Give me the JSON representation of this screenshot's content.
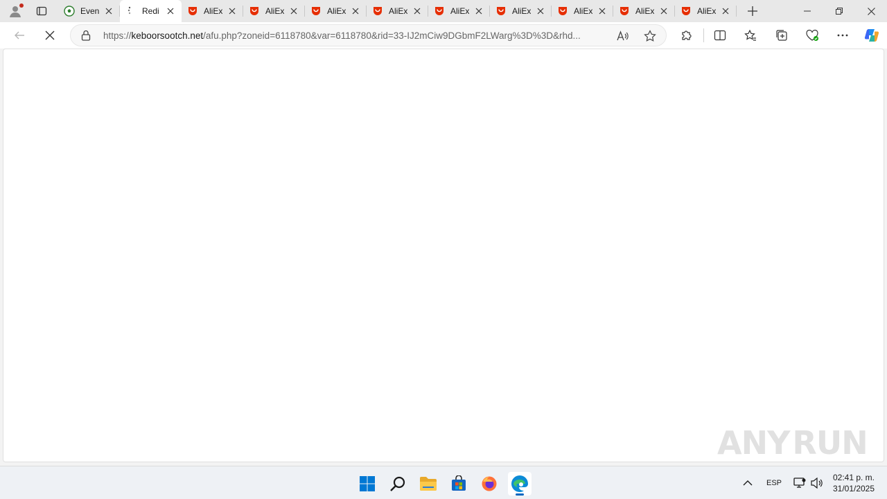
{
  "browser": {
    "tabs": [
      {
        "title": "Even",
        "icon": "soccer-ball-icon",
        "active": false
      },
      {
        "title": "Redi",
        "icon": "loading-icon",
        "active": true
      },
      {
        "title": "AliEx",
        "icon": "aliexpress-icon",
        "active": false
      },
      {
        "title": "AliEx",
        "icon": "aliexpress-icon",
        "active": false
      },
      {
        "title": "AliEx",
        "icon": "aliexpress-icon",
        "active": false
      },
      {
        "title": "AliEx",
        "icon": "aliexpress-icon",
        "active": false
      },
      {
        "title": "AliEx",
        "icon": "aliexpress-icon",
        "active": false
      },
      {
        "title": "AliEx",
        "icon": "aliexpress-icon",
        "active": false
      },
      {
        "title": "AliEx",
        "icon": "aliexpress-icon",
        "active": false
      },
      {
        "title": "AliEx",
        "icon": "aliexpress-icon",
        "active": false
      },
      {
        "title": "AliEx",
        "icon": "aliexpress-icon",
        "active": false
      }
    ],
    "address": {
      "scheme": "https://",
      "host": "keboorsootch.net",
      "path": "/afu.php?zoneid=6118780&var=6118780&rid=33-IJ2mCiw9DGbmF2LWarg%3D%3D&rhd..."
    },
    "colors": {
      "aliexpress_red": "#e62e04",
      "accent": "#0067c0"
    }
  },
  "watermark": {
    "left": "ANY",
    "right": "RUN"
  },
  "taskbar": {
    "language": "ESP",
    "time": "02:41 p. m.",
    "date": "31/01/2025"
  }
}
